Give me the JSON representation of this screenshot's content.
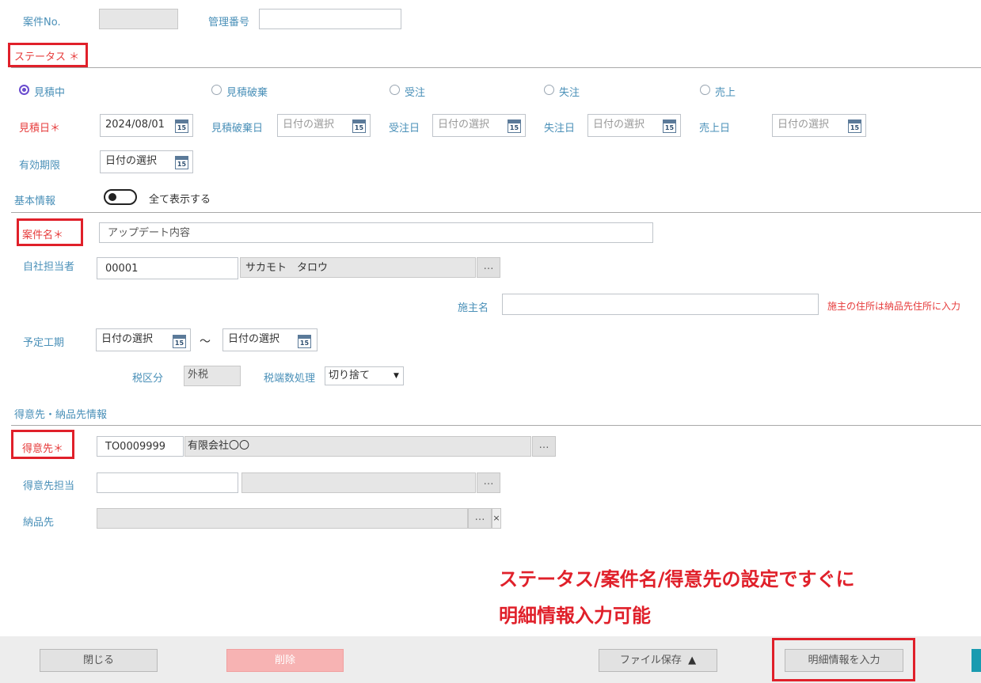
{
  "header": {
    "case_no_label": "案件No.",
    "case_no_value": "",
    "management_no_label": "管理番号",
    "management_no_value": ""
  },
  "status": {
    "section_label": "ステータス",
    "required_mark": "＊",
    "options": [
      "見積中",
      "見積破棄",
      "受注",
      "失注",
      "売上"
    ],
    "selected": "見積中"
  },
  "dates": {
    "estimate_label": "見積日＊",
    "estimate_value": "2024/08/01",
    "discard_label": "見積破棄日",
    "order_label": "受注日",
    "lost_label": "失注日",
    "sales_label": "売上日",
    "placeholder": "日付の選択",
    "validity_label": "有効期限",
    "validity_value": "日付の選択",
    "calendar_icon_text": "15"
  },
  "basic": {
    "section_label": "基本情報",
    "toggle_label": "全て表示する",
    "toggle_on": false,
    "case_name_label": "案件名＊",
    "case_name_value": "アップデート内容",
    "staff_label": "自社担当者",
    "staff_code": "00001",
    "staff_name": "サカモト　タロウ",
    "owner_label": "施主名",
    "owner_value": "",
    "owner_note": "施主の住所は納品先住所に入力",
    "period_label": "予定工期",
    "period_start": "日付の選択",
    "period_tilde": "～",
    "period_end": "日付の選択",
    "tax_label": "税区分",
    "tax_value": "外税",
    "rounding_label": "税端数処理",
    "rounding_value": "切り捨て"
  },
  "customer": {
    "section_label": "得意先・納品先情報",
    "customer_label": "得意先＊",
    "customer_code": "TO0009999",
    "customer_name": "有限会社〇〇",
    "contact_label": "得意先担当",
    "contact_code": "",
    "contact_name": "",
    "delivery_label": "納品先",
    "delivery_value": "",
    "dots": "…",
    "clear": "×"
  },
  "annotation": {
    "line1": "ステータス/案件名/得意先の設定ですぐに",
    "line2": "明細情報入力可能",
    "color": "#e0202a"
  },
  "footer": {
    "close_label": "閉じる",
    "delete_label": "削除",
    "file_save_label": "ファイル保存",
    "file_save_arrow": "▲",
    "detail_label": "明細情報を入力"
  },
  "colors": {
    "label_blue": "#4a90b8",
    "required_red": "#e63b3b",
    "frame_red": "#e0202a",
    "radio_purple": "#6a4ccf",
    "delete_pink": "#f7b3b3",
    "teal_edge": "#1a9bb0"
  }
}
